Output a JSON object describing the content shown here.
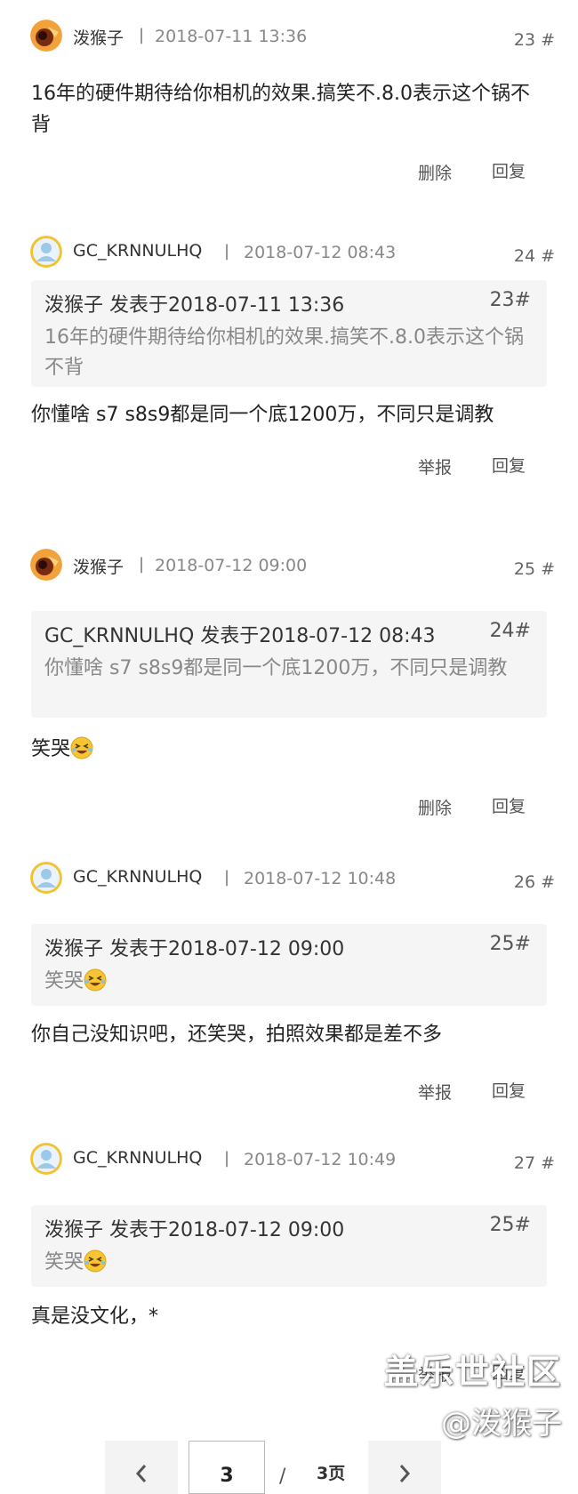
{
  "posts": [
    {
      "author": "泼猴子",
      "date": "2018-07-11 13:36",
      "floor": "23 #",
      "body": "16年的硬件期待给你相机的效果.搞笑不.8.0表示这个锅不背",
      "action1": "删除",
      "action2": "回复"
    },
    {
      "author": "GC_KRNNULHQ",
      "date": "2018-07-12 08:43",
      "floor": "24 #",
      "quote_head": "泼猴子 发表于2018-07-11 13:36",
      "quote_floor": "23#",
      "quote_body": "16年的硬件期待给你相机的效果.搞笑不.8.0表示这个锅不背",
      "body": "你懂啥 s7 s8s9都是同一个底1200万，不同只是调教",
      "action1": "举报",
      "action2": "回复"
    },
    {
      "author": "泼猴子",
      "date": "2018-07-12 09:00",
      "floor": "25 #",
      "quote_head": "GC_KRNNULHQ 发表于2018-07-12 08:43",
      "quote_floor": "24#",
      "quote_body": "你懂啥 s7 s8s9都是同一个底1200万，不同只是调教",
      "body": "笑哭",
      "action1": "删除",
      "action2": "回复"
    },
    {
      "author": "GC_KRNNULHQ",
      "date": "2018-07-12 10:48",
      "floor": "26 #",
      "quote_head": "泼猴子 发表于2018-07-12 09:00",
      "quote_floor": "25#",
      "quote_body": "笑哭",
      "body": "你自己没知识吧，还笑哭，拍照效果都是差不多",
      "action1": "举报",
      "action2": "回复"
    },
    {
      "author": "GC_KRNNULHQ",
      "date": "2018-07-12 10:49",
      "floor": "27 #",
      "quote_head": "泼猴子 发表于2018-07-12 09:00",
      "quote_floor": "25#",
      "quote_body": "笑哭",
      "body": "真是没文化，*",
      "action1": "举报",
      "action2": "回复"
    }
  ],
  "separator": "|",
  "pagination": {
    "current": "3",
    "slash": "/",
    "total": "3页"
  },
  "watermark": {
    "line1": "盖乐世社区",
    "line2": "@泼猴子"
  },
  "icons": {
    "avatar_monkey": "monkey-avatar-icon",
    "avatar_default": "default-user-avatar-icon",
    "emoji": "laughing-tears-emoji-icon",
    "prev": "chevron-left-icon",
    "next": "chevron-right-icon"
  },
  "colors": {
    "quote_bg": "#f5f5f5",
    "avatar_ring": "#f2c230"
  }
}
